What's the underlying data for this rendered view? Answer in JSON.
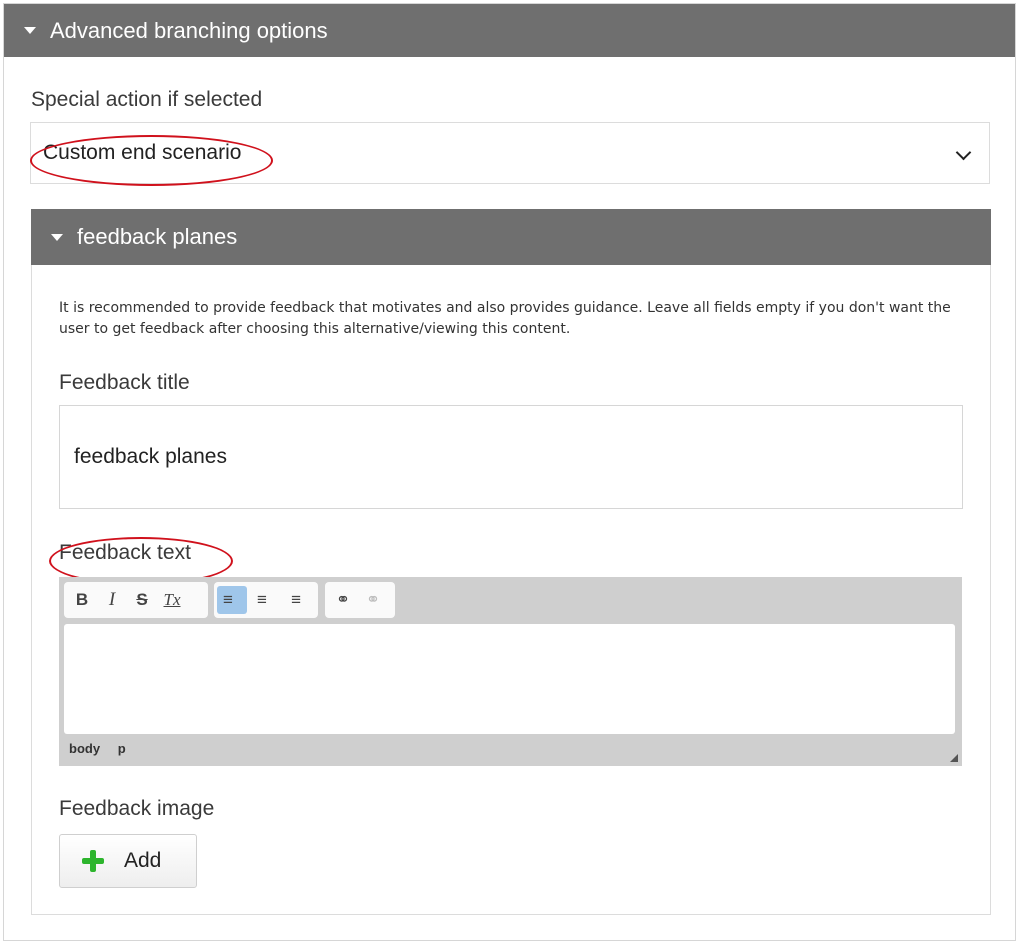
{
  "advanced": {
    "title": "Advanced branching options"
  },
  "special_action": {
    "label": "Special action if selected",
    "value": "Custom end scenario"
  },
  "feedback": {
    "title": "feedback planes",
    "description": "It is recommended to provide feedback that motivates and also provides guidance. Leave all fields empty if you don't want the user to get feedback after choosing this alternative/viewing this content.",
    "title_label": "Feedback title",
    "title_value": "feedback planes",
    "text_label": "Feedback text",
    "editor": {
      "toolbar": {
        "bold": "B",
        "italic": "I",
        "strike": "S",
        "clear": "Tx",
        "align_left": "≡",
        "align_center": "≡",
        "align_right": "≡",
        "link": "⚭",
        "unlink": "⚭"
      },
      "path": [
        "body",
        "p"
      ]
    },
    "image_label": "Feedback image",
    "add_label": "Add"
  },
  "colors": {
    "header_bg": "#6f6f6f",
    "annotation": "#d0111c",
    "add_icon": "#2db52d"
  }
}
